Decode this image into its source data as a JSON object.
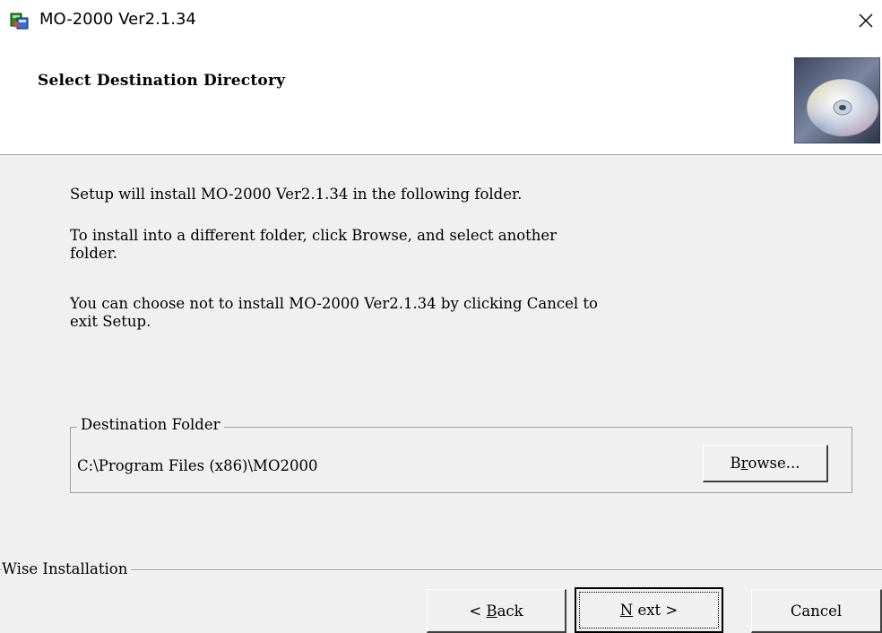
{
  "window": {
    "title": "MO-2000 Ver2.1.34",
    "icons": {
      "app": "installer-app-icon",
      "close": "close-icon"
    }
  },
  "header": {
    "title": "Select Destination Directory",
    "graphic": "cd-disc-icon"
  },
  "content": {
    "paragraphs": [
      "Setup will install MO-2000 Ver2.1.34 in the following folder.",
      "To install into a different folder, click Browse, and select another\nfolder.",
      "You can choose not to install MO-2000 Ver2.1.34 by clicking Cancel to\nexit Setup."
    ]
  },
  "destination": {
    "legend": "Destination Folder",
    "path": "C:\\Program Files (x86)\\MO2000",
    "browse_prefix": "B",
    "browse_mnemonic": "r",
    "browse_suffix": "owse..."
  },
  "footer": {
    "brand": "Wise Installation",
    "back_prefix": "< ",
    "back_mnemonic": "B",
    "back_suffix": "ack",
    "next_mnemonic": "N",
    "next_suffix": "ext >",
    "cancel": "Cancel"
  }
}
